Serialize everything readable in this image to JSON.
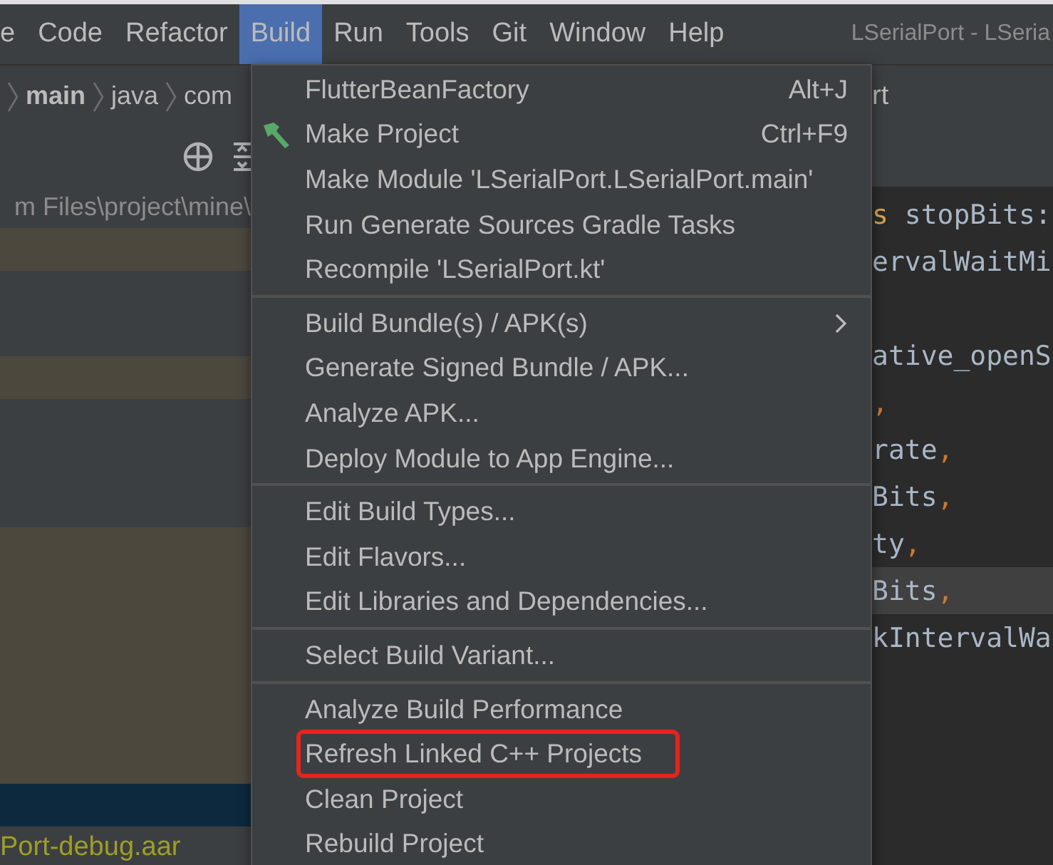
{
  "menubar": {
    "items": [
      {
        "label": "e",
        "selected": false
      },
      {
        "label": "Code",
        "selected": false
      },
      {
        "label": "Refactor",
        "selected": false
      },
      {
        "label": "Build",
        "selected": true
      },
      {
        "label": "Run",
        "selected": false
      },
      {
        "label": "Tools",
        "selected": false
      },
      {
        "label": "Git",
        "selected": false
      },
      {
        "label": "Window",
        "selected": false
      },
      {
        "label": "Help",
        "selected": false
      }
    ],
    "title": "LSerialPort - LSeria"
  },
  "breadcrumb": {
    "items": [
      {
        "label": "main",
        "bold": true
      },
      {
        "label": "java",
        "bold": false
      },
      {
        "label": "com",
        "bold": false
      }
    ],
    "tab_fragment": "rt"
  },
  "project_panel": {
    "path": "m Files\\project\\mine\\",
    "rows": [
      {
        "kind": "modified"
      },
      {
        "kind": "plain"
      },
      {
        "kind": "plain"
      },
      {
        "kind": "modified"
      },
      {
        "kind": "plain"
      },
      {
        "kind": "plain"
      },
      {
        "kind": "plain"
      },
      {
        "kind": "modified"
      },
      {
        "kind": "modified"
      },
      {
        "kind": "modified"
      },
      {
        "kind": "modified"
      },
      {
        "kind": "modified"
      },
      {
        "kind": "modified"
      },
      {
        "kind": "selected"
      },
      {
        "kind": "file",
        "text": "Port-debug.aar"
      }
    ]
  },
  "editor": {
    "lines": [
      {
        "kind": "code",
        "segments": [
          {
            "kind": "keyword",
            "text": "s"
          },
          {
            "kind": "plain",
            "text": " stopBits:"
          }
        ]
      },
      {
        "kind": "code",
        "segments": [
          {
            "kind": "plain",
            "text": "ervalWaitMi"
          }
        ]
      },
      {
        "kind": "blank"
      },
      {
        "kind": "code",
        "segments": [
          {
            "kind": "plain",
            "text": "ative_openS"
          }
        ]
      },
      {
        "kind": "code",
        "segments": [
          {
            "kind": "punct",
            "text": ","
          }
        ]
      },
      {
        "kind": "code",
        "segments": [
          {
            "kind": "plain",
            "text": "rate"
          },
          {
            "kind": "punct",
            "text": ","
          }
        ]
      },
      {
        "kind": "code",
        "segments": [
          {
            "kind": "plain",
            "text": "Bits"
          },
          {
            "kind": "punct",
            "text": ","
          }
        ]
      },
      {
        "kind": "code",
        "segments": [
          {
            "kind": "plain",
            "text": "ty"
          },
          {
            "kind": "punct",
            "text": ","
          }
        ]
      },
      {
        "kind": "current",
        "segments": [
          {
            "kind": "plain",
            "text": "Bits"
          },
          {
            "kind": "punct",
            "text": ","
          }
        ]
      },
      {
        "kind": "code",
        "segments": [
          {
            "kind": "plain",
            "text": "kIntervalWa"
          }
        ]
      }
    ]
  },
  "build_menu": {
    "items": [
      {
        "kind": "item",
        "label": "FlutterBeanFactory",
        "shortcut": "Alt+J",
        "annotated": false
      },
      {
        "kind": "tool_item",
        "label": "Make Project",
        "shortcut": "Ctrl+F9",
        "annotated": false
      },
      {
        "kind": "item",
        "label": "Make Module 'LSerialPort.LSerialPort.main'",
        "annotated": false
      },
      {
        "kind": "item",
        "label": "Run Generate Sources Gradle Tasks",
        "annotated": false
      },
      {
        "kind": "item",
        "label": "Recompile 'LSerialPort.kt'",
        "annotated": false
      },
      {
        "kind": "separator"
      },
      {
        "kind": "item",
        "label": "Build Bundle(s) / APK(s)",
        "submenu": true,
        "annotated": false
      },
      {
        "kind": "item",
        "label": "Generate Signed Bundle / APK...",
        "annotated": false
      },
      {
        "kind": "item",
        "label": "Analyze APK...",
        "annotated": false
      },
      {
        "kind": "item",
        "label": "Deploy Module to App Engine...",
        "annotated": false
      },
      {
        "kind": "separator"
      },
      {
        "kind": "item",
        "label": "Edit Build Types...",
        "annotated": false
      },
      {
        "kind": "item",
        "label": "Edit Flavors...",
        "annotated": false
      },
      {
        "kind": "item",
        "label": "Edit Libraries and Dependencies...",
        "annotated": false
      },
      {
        "kind": "separator"
      },
      {
        "kind": "item",
        "label": "Select Build Variant...",
        "annotated": false
      },
      {
        "kind": "separator"
      },
      {
        "kind": "item",
        "label": "Analyze Build Performance",
        "annotated": false
      },
      {
        "kind": "item",
        "label": "Refresh Linked C++ Projects",
        "annotated": true
      },
      {
        "kind": "item",
        "label": "Clean Project",
        "annotated": false
      },
      {
        "kind": "item",
        "label": "Rebuild Project",
        "annotated": false
      }
    ]
  }
}
